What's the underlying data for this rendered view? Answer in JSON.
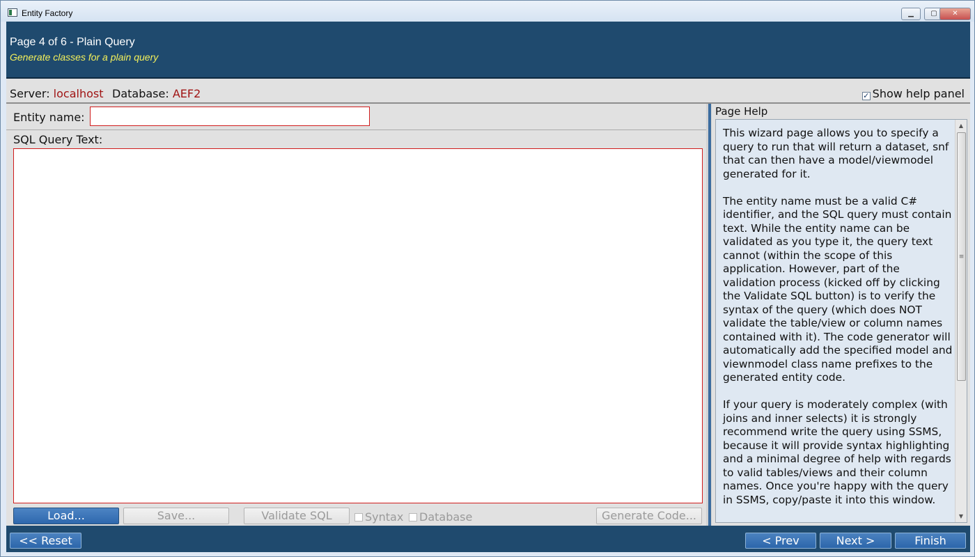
{
  "window": {
    "title": "Entity Factory",
    "minimize": "▁",
    "maximize": "▢",
    "close": "✕"
  },
  "header": {
    "title": "Page 4 of 6 - Plain Query",
    "subtitle": "Generate classes for a plain query"
  },
  "info": {
    "server_label": "Server:",
    "server_value": "localhost",
    "database_label": "Database:",
    "database_value": "AEF2",
    "show_help_label": "Show help panel",
    "show_help_checked": true
  },
  "form": {
    "entity_label": "Entity name:",
    "entity_value": "",
    "sql_label": "SQL Query Text:",
    "sql_value": ""
  },
  "toolbar": {
    "load": "Load...",
    "save": "Save...",
    "validate": "Validate SQL",
    "syntax": "Syntax",
    "database": "Database",
    "generate": "Generate Code..."
  },
  "help": {
    "title": "Page Help",
    "paragraphs": [
      "This wizard page allows you to specify a query to run that will return a dataset, snf that can then have a model/viewmodel generated for it.",
      "The entity name must be a valid C# identifier, and the SQL query must contain text. While the entity name can be validated as you type it, the query text cannot (within the scope of this application. However, part of the validation process (kicked off by clicking the Validate SQL button) is to verify the syntax of the query (which does NOT validate the table/view or column names contained with it). The code generator will automatically add the specified model and viewnmodel class name prefixes to the generated entity code.",
      "If your query is moderately complex (with joins and inner selects) it is strongly recommend write the query using SSMS, because it will provide syntax highlighting and a minimal degree of help with regards to valid tables/views and their column names. Once you're happy with the query in SSMS, copy/paste it into this window."
    ],
    "scroll_thumb_glyph": "≡",
    "scroll_up_glyph": "▲",
    "scroll_down_glyph": "▼"
  },
  "footer": {
    "reset": "<< Reset",
    "prev": "< Prev",
    "next": "Next >",
    "finish": "Finish"
  },
  "colors": {
    "header_bg": "#1f4a6e",
    "subtitle": "#f5f15a",
    "error_border": "#d01c1c",
    "value_red": "#a01414"
  }
}
